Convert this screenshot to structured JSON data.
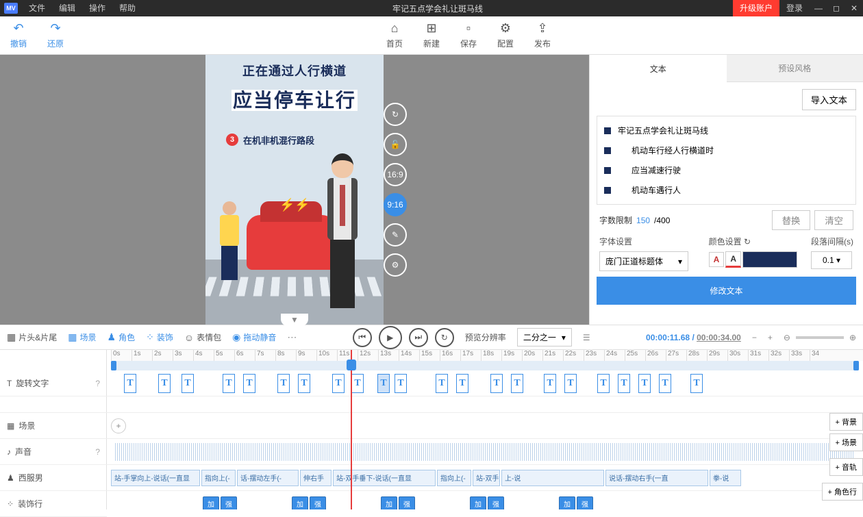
{
  "titlebar": {
    "logo": "MV",
    "menus": [
      "文件",
      "编辑",
      "操作",
      "帮助"
    ],
    "title": "牢记五点学会礼让斑马线",
    "upgrade": "升级账户",
    "login": "登录"
  },
  "toolbar": {
    "undo": "撤销",
    "redo": "还原",
    "home": "首页",
    "new": "新建",
    "save": "保存",
    "config": "配置",
    "publish": "发布"
  },
  "canvas": {
    "text1": "正在通过人行横道",
    "text2": "应当停车让行",
    "badge": "3",
    "text3": "在机非机混行路段",
    "tools": {
      "ratio1": "16:9",
      "ratio2": "9:16"
    }
  },
  "rightpanel": {
    "tabs": [
      "文本",
      "预设风格"
    ],
    "import": "导入文本",
    "items": [
      "牢记五点学会礼让斑马线",
      "机动车行经人行横道时",
      "应当减速行驶",
      "机动车遇行人"
    ],
    "count_label": "字数限制",
    "count_cur": "150",
    "count_sep": "/400",
    "replace": "替换",
    "clear": "清空",
    "font_label": "字体设置",
    "font_value": "庞门正道标题体",
    "color_label": "颜色设置",
    "gap_label": "段落间隔(s)",
    "gap_value": "0.1",
    "modify": "修改文本"
  },
  "midbar": {
    "head_tail": "片头&片尾",
    "scene": "场景",
    "role": "角色",
    "deco": "装饰",
    "emoji": "表情包",
    "drag_mute": "拖动静音",
    "preview_label": "预览分辨率",
    "preview_value": "二分之一",
    "time_cur": "00:00:11.68",
    "time_sep": " / ",
    "time_total": "00:00:34.00"
  },
  "timeline": {
    "ticks": [
      "0s",
      "1s",
      "2s",
      "3s",
      "4s",
      "5s",
      "6s",
      "7s",
      "8s",
      "9s",
      "10s",
      "11s",
      "12s",
      "13s",
      "14s",
      "15s",
      "16s",
      "17s",
      "18s",
      "19s",
      "20s",
      "21s",
      "22s",
      "23s",
      "24s",
      "25s",
      "26s",
      "27s",
      "28s",
      "29s",
      "30s",
      "31s",
      "32s",
      "33s",
      "34"
    ],
    "labels": {
      "rotate_text": "旋转文字",
      "scene": "场景",
      "sound": "声音",
      "suit_man": "西服男",
      "deco_row": "装饰行"
    },
    "char_clips": [
      "站-手掌向上-说话(一直显",
      "指向上(-",
      "话-摆动左手(-",
      "伸右手",
      "站-双手垂下-说话(一直显",
      "指向上(-",
      "站-双手解说(一直显示)",
      "上-说",
      "说话-摆动右手(一直",
      "拳-说"
    ],
    "deco_clips": [
      "加",
      "强",
      "加",
      "强",
      "加",
      "强",
      "加",
      "强",
      "加",
      "强"
    ],
    "right_btns": [
      "+ 背景",
      "+ 场景",
      "+ 音轨",
      "+ 角色行"
    ]
  }
}
